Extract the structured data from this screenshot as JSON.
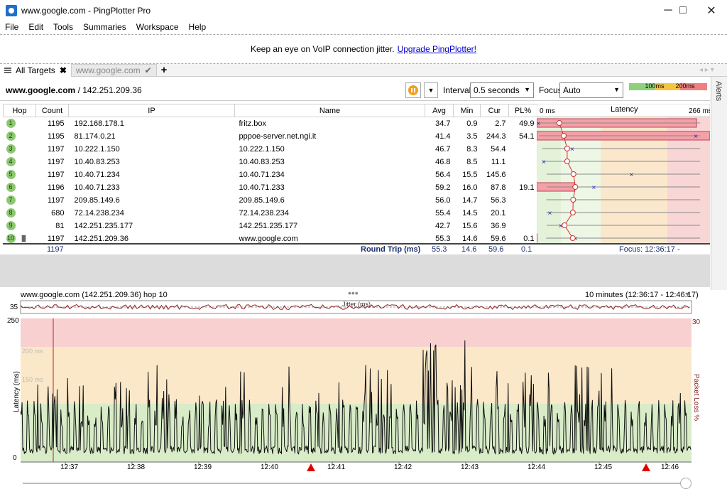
{
  "window": {
    "title": "www.google.com - PingPlotter Pro",
    "minimize": "─",
    "maximize": "□",
    "close": "✕"
  },
  "menu": [
    "File",
    "Edit",
    "Tools",
    "Summaries",
    "Workspace",
    "Help"
  ],
  "banner": {
    "text": "Keep an eye on VoIP connection jitter.",
    "link": "Upgrade PingPlotter!"
  },
  "tabs": [
    {
      "label": "All Targets"
    },
    {
      "label": "www.google.com"
    }
  ],
  "target": {
    "host": "www.google.com",
    "ip": "/ 142.251.209.36"
  },
  "interval": {
    "label": "Interval",
    "value": "0.5 seconds"
  },
  "focus": {
    "label": "Focus",
    "value": "Auto"
  },
  "legend": {
    "l100": "100ms",
    "l200": "200ms"
  },
  "alerts": "Alerts",
  "table": {
    "headers": {
      "hop": "Hop",
      "count": "Count",
      "ip": "IP",
      "name": "Name",
      "avg": "Avg",
      "min": "Min",
      "cur": "Cur",
      "pl": "PL%",
      "lat0": "0 ms",
      "latency": "Latency",
      "latmax": "266 ms"
    },
    "rows": [
      {
        "hop": "1",
        "count": "1195",
        "ip": "192.168.178.1",
        "name": "fritz.box",
        "avg": "34.7",
        "min": "0.9",
        "cur": "2.7",
        "pl": "49.9"
      },
      {
        "hop": "2",
        "count": "1195",
        "ip": "81.174.0.21",
        "name": "pppoe-server.net.ngi.it",
        "avg": "41.4",
        "min": "3.5",
        "cur": "244.3",
        "pl": "54.1"
      },
      {
        "hop": "3",
        "count": "1197",
        "ip": "10.222.1.150",
        "name": "10.222.1.150",
        "avg": "46.7",
        "min": "8.3",
        "cur": "54.4",
        "pl": ""
      },
      {
        "hop": "4",
        "count": "1197",
        "ip": "10.40.83.253",
        "name": "10.40.83.253",
        "avg": "46.8",
        "min": "8.5",
        "cur": "11.1",
        "pl": ""
      },
      {
        "hop": "5",
        "count": "1197",
        "ip": "10.40.71.234",
        "name": "10.40.71.234",
        "avg": "56.4",
        "min": "15.5",
        "cur": "145.6",
        "pl": ""
      },
      {
        "hop": "6",
        "count": "1196",
        "ip": "10.40.71.233",
        "name": "10.40.71.233",
        "avg": "59.2",
        "min": "16.0",
        "cur": "87.8",
        "pl": "19.1"
      },
      {
        "hop": "7",
        "count": "1197",
        "ip": "209.85.149.6",
        "name": "209.85.149.6",
        "avg": "56.0",
        "min": "14.7",
        "cur": "56.3",
        "pl": ""
      },
      {
        "hop": "8",
        "count": "680",
        "ip": "72.14.238.234",
        "name": "72.14.238.234",
        "avg": "55.4",
        "min": "14.5",
        "cur": "20.1",
        "pl": ""
      },
      {
        "hop": "9",
        "count": "81",
        "ip": "142.251.235.177",
        "name": "142.251.235.177",
        "avg": "42.7",
        "min": "15.6",
        "cur": "36.9",
        "pl": ""
      },
      {
        "hop": "10",
        "count": "1197",
        "ip": "142.251.209.36",
        "name": "www.google.com",
        "avg": "55.3",
        "min": "14.6",
        "cur": "59.6",
        "pl": "0.1"
      }
    ],
    "summary": {
      "count": "1197",
      "label": "Round Trip (ms)",
      "avg": "55.3",
      "min": "14.6",
      "cur": "59.6",
      "pl": "0.1",
      "focus": "Focus: 12:36:17 - 12:46:17"
    }
  },
  "graph": {
    "title": "www.google.com (142.251.209.36) hop 10",
    "range": "10 minutes (12:36:17 - 12:46:17)",
    "jitter_label": "Jitter (ms)",
    "jitter_max": "35",
    "ylabel": "Latency (ms)",
    "y2label": "Packet Loss %",
    "y_top": "250",
    "y_200": "200 ms",
    "y_150": "150 ms",
    "y_zero": "0",
    "y2_top": "30",
    "times": [
      "12:37",
      "12:38",
      "12:39",
      "12:40",
      "12:41",
      "12:42",
      "12:43",
      "12:44",
      "12:45",
      "12:46"
    ]
  },
  "colors": {
    "green": "#d8ecc8",
    "yellow": "#fbe8c8",
    "red": "#f8d0d0",
    "accent": "#f0a020",
    "hop_green": "#8cc870"
  }
}
